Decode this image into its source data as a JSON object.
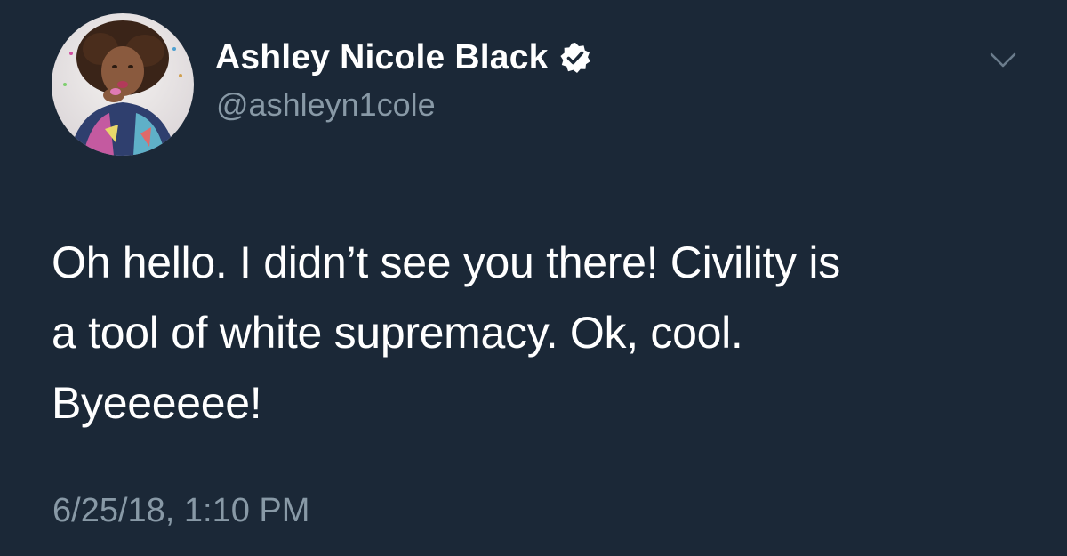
{
  "author": {
    "display_name": "Ashley Nicole Black",
    "handle": "@ashleyn1cole",
    "verified": true,
    "avatar_icon": "profile-photo"
  },
  "tweet": {
    "lines": [
      "Oh hello. I didn’t see you there! Civility is",
      "a tool of white supremacy. Ok, cool.",
      "Byeeeeee!"
    ],
    "timestamp": "6/25/18, 1:10 PM"
  },
  "icons": {
    "verified": "verified-badge-icon",
    "menu": "chevron-down-icon"
  },
  "colors": {
    "background": "#1b2837",
    "primary_text": "#ffffff",
    "secondary_text": "#8899a6",
    "chevron": "#6b7c8c"
  }
}
